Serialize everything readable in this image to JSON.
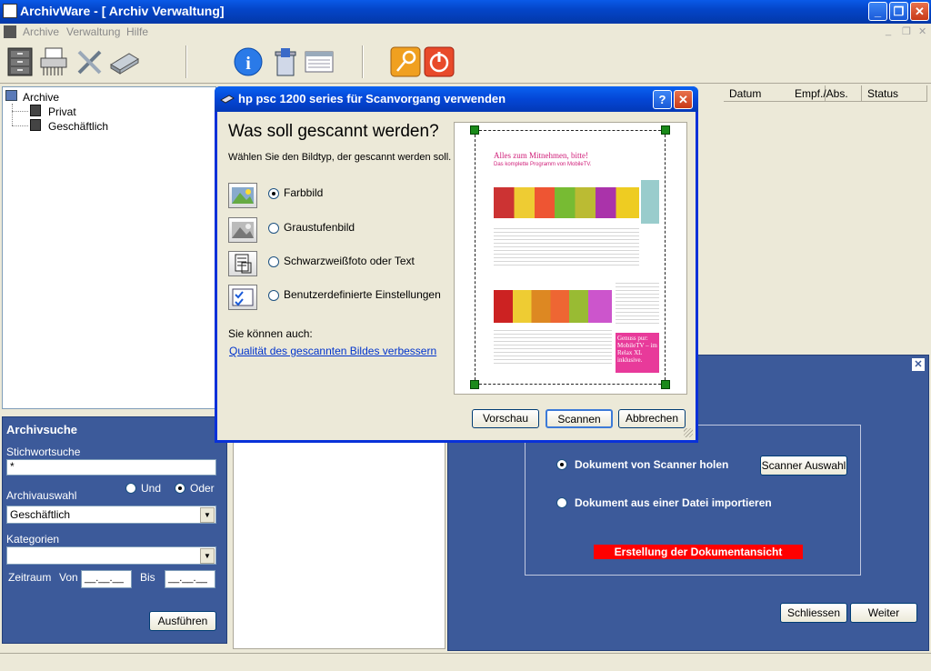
{
  "window": {
    "title": "ArchivWare - [ Archiv Verwaltung]"
  },
  "menu": {
    "items": [
      "Archive",
      "Verwaltung",
      "Hilfe"
    ]
  },
  "toolbar": {
    "icons": [
      "cabinet-icon",
      "shredder-icon",
      "tools-icon",
      "scanner-icon",
      "info-icon",
      "trash-icon",
      "form-icon",
      "key-icon",
      "power-icon"
    ]
  },
  "tree": {
    "root": "Archive",
    "children": [
      "Privat",
      "Geschäftlich"
    ]
  },
  "list": {
    "columns": [
      "Datum",
      "Empf./Abs.",
      "Status"
    ]
  },
  "search": {
    "title": "Archivsuche",
    "keyword_label": "Stichwortsuche",
    "keyword_value": "*",
    "archive_label": "Archivauswahl",
    "and_label": "Und",
    "or_label": "Oder",
    "archive_value": "Geschäftlich",
    "categories_label": "Kategorien",
    "categories_value": "",
    "period_label": "Zeitraum",
    "from_label": "Von",
    "to_label": "Bis",
    "from_value": "__.__.__",
    "to_value": "__.__.__",
    "run_button": "Ausführen"
  },
  "wizard": {
    "option_scanner": "Dokument von Scanner holen",
    "option_file": "Dokument aus einer Datei importieren",
    "scanner_select_button": "Scanner Auswahl",
    "status_bar": "Erstellung der Dokumentansicht",
    "close_button": "Schliessen",
    "next_button": "Weiter"
  },
  "dialog": {
    "title": "hp psc 1200 series für Scanvorgang verwenden",
    "heading": "Was soll gescannt werden?",
    "subheading": "Wählen Sie den Bildtyp, der gescannt werden soll.",
    "options": [
      "Farbbild",
      "Graustufenbild",
      "Schwarzweißfoto oder Text",
      "Benutzerdefinierte Einstellungen"
    ],
    "also_label": "Sie können auch:",
    "improve_link": "Qualität des gescannten Bildes verbessern",
    "preview_button": "Vorschau",
    "scan_button": "Scannen",
    "cancel_button": "Abbrechen",
    "help_button": "?",
    "close_button": "✕"
  },
  "preview_doc": {
    "headline": "Alles zum Mitnehmen, bitte!",
    "subline": "Das komplette Programm von MobileTV.",
    "promo": "Genuss pur: MobileTV – im Relax XL inklusive."
  }
}
